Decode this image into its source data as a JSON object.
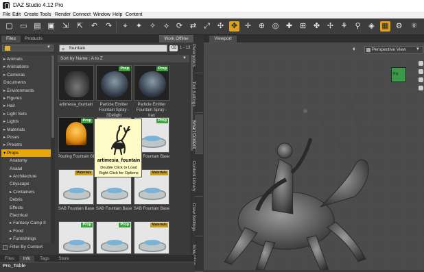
{
  "window": {
    "title": "DAZ Studio 4.12 Pro"
  },
  "menu": [
    "File",
    "Edit",
    "Create",
    "Tools",
    "Render",
    "Connect",
    "Window",
    "Help",
    "Content"
  ],
  "toolbar": {
    "icons": [
      "new-scene-icon",
      "open-icon",
      "open-file-icon",
      "save-icon",
      "merge-icon",
      "export-icon",
      "undo-icon",
      "redo-icon",
      "select-icon",
      "node-select-icon",
      "joint-editor-icon",
      "geometry-editor-icon",
      "rotate-icon",
      "translate-icon",
      "scale-icon",
      "universal-tool-icon",
      "active-pose-icon",
      "region-nav-icon",
      "spot-render-icon",
      "camera-icon",
      "light-icon",
      "transform-icon",
      "pose-icon",
      "move-icon",
      "bone-icon",
      "figure-icon",
      "primitive-icon",
      "surface-icon",
      "render-icon",
      "render-settings-icon"
    ],
    "active_index": 15
  },
  "left_tabs": {
    "files": "Files",
    "products": "Products",
    "work_offline": "Work Offline"
  },
  "categories": [
    "▸ Animals",
    "▸ Animations",
    "▸ Cameras",
    "Documents",
    "▸ Environments",
    "▸ Figures",
    "▸ Hair",
    "▸ Light Sets",
    "▸ Lights",
    "▸ Materials",
    "▸ Poses",
    "▸ Presets",
    "▾ Props",
    "Anatomy",
    "Anatal",
    "▸ Architecture",
    "Cityscape",
    "▸ Containers",
    "Debris",
    "Effects",
    "Electrical",
    "▸ Fantasy Camp II",
    "▸ Food",
    "▸ Furnishings"
  ],
  "selected_category_index": 12,
  "filter_label": "Filter By Context",
  "search": {
    "value": "fountain",
    "clear_label": "⌫",
    "count": "1 - 13"
  },
  "sort": {
    "label": "Sort by Name : A to Z"
  },
  "items": [
    {
      "name": "artimesia_fountain",
      "badge": "",
      "kind": "artimesia"
    },
    {
      "name": "Particle Emitter Fountain Spray - 3Delight",
      "badge": "Prop",
      "kind": "particle"
    },
    {
      "name": "Particle Emitter Fountain Spray - Iray",
      "badge": "Prop",
      "kind": "particle"
    },
    {
      "name": "Pouring Fountain 01",
      "badge": "Prop",
      "kind": "spray"
    },
    {
      "name": "SAB Fountain Base",
      "badge": "Prop",
      "kind": "fountain"
    },
    {
      "name": "SAB Fountain Base",
      "badge": "Prop",
      "kind": "fountain"
    },
    {
      "name": "SAB Fountain Base",
      "badge": "Materials",
      "kind": "fountain"
    },
    {
      "name": "SAB Fountain Base",
      "badge": "Materials",
      "kind": "fountain"
    },
    {
      "name": "SAB Fountain Base",
      "badge": "Materials",
      "kind": "fountain"
    },
    {
      "name": "",
      "badge": "Prop",
      "kind": "fountain"
    },
    {
      "name": "",
      "badge": "Prop",
      "kind": "fountain"
    },
    {
      "name": "",
      "badge": "Materials",
      "kind": "fountain"
    }
  ],
  "tooltip": {
    "name": "artimesia_fountain",
    "line1": "Double Click to Load",
    "line2": "Right Click for Options"
  },
  "side_tabs": [
    "Parameters",
    "Tool Settings",
    "Smart Content",
    "Content Library",
    "Draw Settings",
    "Simulation"
  ],
  "active_side_tab": 2,
  "bottom_tabs": [
    "Files",
    "Info",
    "Tags",
    "Store"
  ],
  "active_bottom_tab": 1,
  "bottom_panel_title": "Pro_Table",
  "viewport": {
    "tab": "Viewport",
    "camera": "Perspective View",
    "cube_label": "Rig"
  },
  "colors": {
    "accent": "#e8a80c",
    "prop_badge": "#39a339",
    "material_badge": "#c8a020",
    "tooltip_bg": "#fffbc7"
  }
}
